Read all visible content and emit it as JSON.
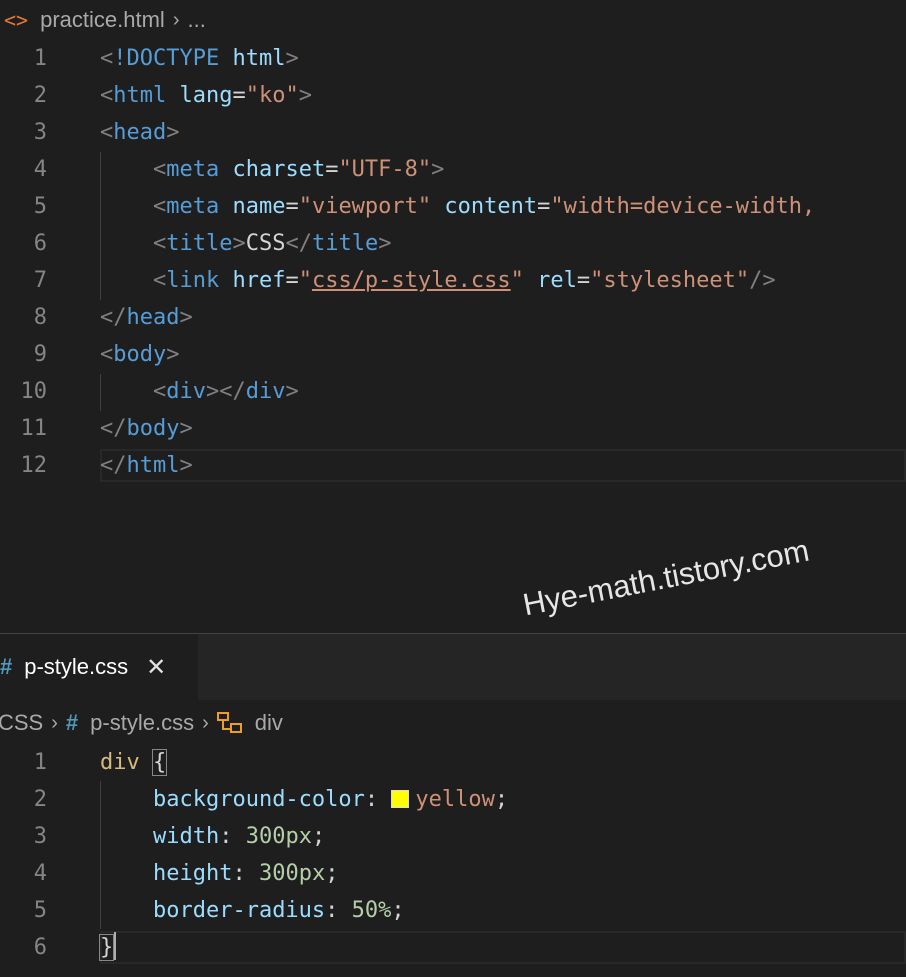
{
  "top_breadcrumb": {
    "file_icon": "html-code-icon",
    "file": "practice.html",
    "rest": "..."
  },
  "html_editor": {
    "lines": [
      {
        "n": "1"
      },
      {
        "n": "2"
      },
      {
        "n": "3"
      },
      {
        "n": "4"
      },
      {
        "n": "5"
      },
      {
        "n": "6"
      },
      {
        "n": "7"
      },
      {
        "n": "8"
      },
      {
        "n": "9"
      },
      {
        "n": "10"
      },
      {
        "n": "11"
      },
      {
        "n": "12"
      }
    ],
    "tokens": {
      "l1_doctype": "!DOCTYPE",
      "l1_html": "html",
      "l2_tag": "html",
      "l2_attr": "lang",
      "l2_val": "\"ko\"",
      "l3_tag": "head",
      "l4_tag": "meta",
      "l4_attr": "charset",
      "l4_val": "\"UTF-8\"",
      "l5_tag": "meta",
      "l5_attr1": "name",
      "l5_val1": "\"viewport\"",
      "l5_attr2": "content",
      "l5_val2": "\"width=device-width,",
      "l6_tag": "title",
      "l6_text": "CSS",
      "l6_endtag": "title",
      "l7_tag": "link",
      "l7_attr1": "href",
      "l7_val1_q": "\"",
      "l7_val1": "css/p-style.css",
      "l7_attr2": "rel",
      "l7_val2": "\"stylesheet\"",
      "l8_tag": "head",
      "l9_tag": "body",
      "l10_tag": "div",
      "l10_endtag": "div",
      "l11_tag": "body",
      "l12_tag": "html"
    }
  },
  "watermark": "Hye-math.tistory.com",
  "css_tab": {
    "icon": "css-hash-icon",
    "label": "p-style.css",
    "close": "✕"
  },
  "css_breadcrumb": {
    "folder": "CSS",
    "file": "p-style.css",
    "symbol": "div"
  },
  "css_editor": {
    "lines": [
      {
        "n": "1"
      },
      {
        "n": "2"
      },
      {
        "n": "3"
      },
      {
        "n": "4"
      },
      {
        "n": "5"
      },
      {
        "n": "6"
      }
    ],
    "tokens": {
      "selector": "div",
      "p1": "background-color",
      "v1": "yellow",
      "swatch_color": "#ffff00",
      "p2": "width",
      "v2": "300px",
      "p3": "height",
      "v3": "300px",
      "p4": "border-radius",
      "v4": "50%"
    }
  }
}
